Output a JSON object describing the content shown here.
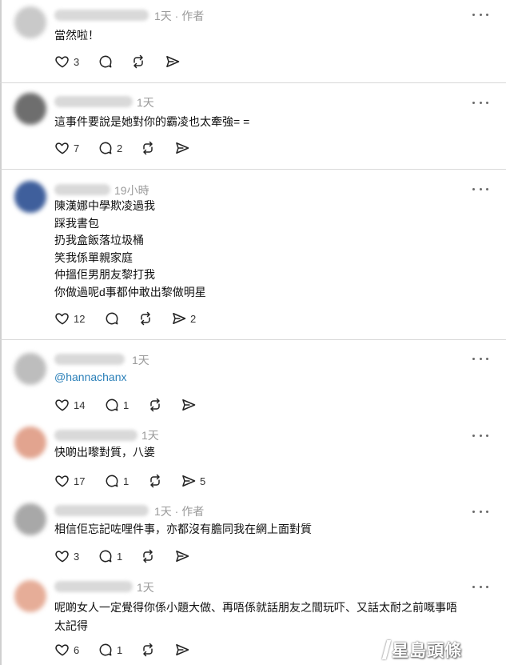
{
  "posts": [
    {
      "time": "1天 · 作者",
      "text": "當然啦！",
      "likes": "3",
      "comments": "",
      "reposts": "",
      "shares": "",
      "avatar_color": "#c9c9c9"
    },
    {
      "time": "1天",
      "text": "這事件要說是她對你的霸凌也太牽強= =",
      "likes": "7",
      "comments": "2",
      "reposts": "",
      "shares": "",
      "avatar_color": "#6e6e6e"
    },
    {
      "time": "19小時",
      "text": "陳漢娜中學欺凌過我\n踩我書包\n扔我盒飯落垃圾桶\n笑我係單親家庭\n仲搵佢男朋友黎打我\n你做過呢d事都仲敢出黎做明星",
      "likes": "12",
      "comments": "",
      "reposts": "",
      "shares": "2",
      "avatar_color": "#3f5f9c"
    },
    {
      "time": "1天",
      "text": "@hannachanx",
      "likes": "14",
      "comments": "1",
      "reposts": "",
      "shares": "",
      "avatar_color": "#bdbdbd"
    },
    {
      "time": "1天",
      "text": "快啲出嚟對質，八婆",
      "likes": "17",
      "comments": "1",
      "reposts": "",
      "shares": "5",
      "avatar_color": "#e2a48f"
    },
    {
      "time": "1天 · 作者",
      "text": "相信佢忘記咗哩件事，亦都沒有膽同我在網上面對質",
      "likes": "3",
      "comments": "1",
      "reposts": "",
      "shares": "",
      "avatar_color": "#a8a8a8"
    },
    {
      "time": "1天",
      "text": "呢啲女人一定覺得你係小題大做、再唔係就話朋友之間玩吓、又話太耐之前嘅事唔\n太記得",
      "likes": "6",
      "comments": "1",
      "reposts": "",
      "shares": "",
      "avatar_color": "#e6ad98"
    }
  ],
  "watermark": "星島頭條",
  "colors": {
    "mention": "#2a7fb8",
    "time": "#9a9a9a",
    "separator": "#d8d8d8"
  },
  "icons": [
    "heart-icon",
    "comment-icon",
    "repost-icon",
    "share-icon",
    "more-icon"
  ]
}
